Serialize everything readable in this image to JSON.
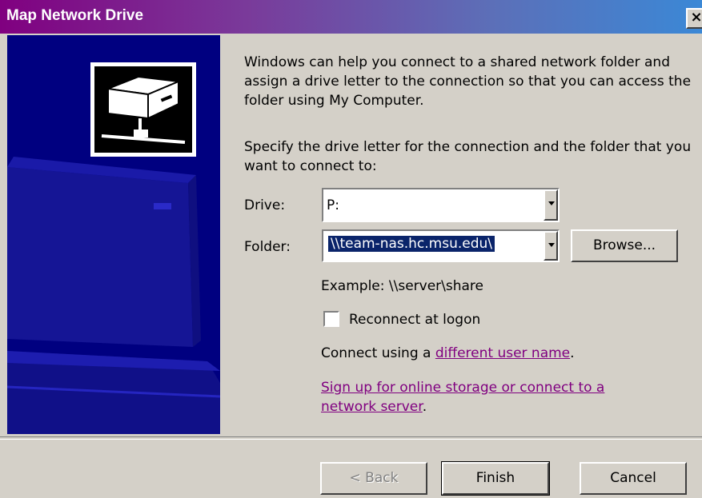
{
  "window": {
    "title": "Map Network Drive",
    "close_glyph": "×"
  },
  "intro": {
    "text1": "Windows can help you connect to a shared network folder and assign a drive letter to the connection so that you can access the folder using My Computer.",
    "text2": "Specify the drive letter for the connection and the folder that you want to connect to:"
  },
  "drive": {
    "label": "Drive:",
    "value": "P:"
  },
  "folder": {
    "label": "Folder:",
    "value": "\\\\team-nas.hc.msu.edu\\",
    "browse_label": "Browse..."
  },
  "example": "Example: \\\\server\\share",
  "reconnect": {
    "label": "Reconnect at logon",
    "checked": false
  },
  "connect_using": {
    "prefix": "Connect using a ",
    "link": "different user name",
    "suffix": "."
  },
  "signup": {
    "link_line1": "Sign up for online storage or connect to a",
    "link_line2": "network server",
    "suffix": "."
  },
  "buttons": {
    "back": "< Back",
    "finish": "Finish",
    "cancel": "Cancel"
  },
  "colors": {
    "side_panel": "#000080",
    "title_start": "#800080",
    "title_end": "#3b88d6",
    "link": "#800080",
    "selection": "#0a246a"
  },
  "icons": {
    "side_art": "network-drive-icon",
    "close": "close-icon",
    "dropdown": "dropdown-arrow-icon"
  }
}
